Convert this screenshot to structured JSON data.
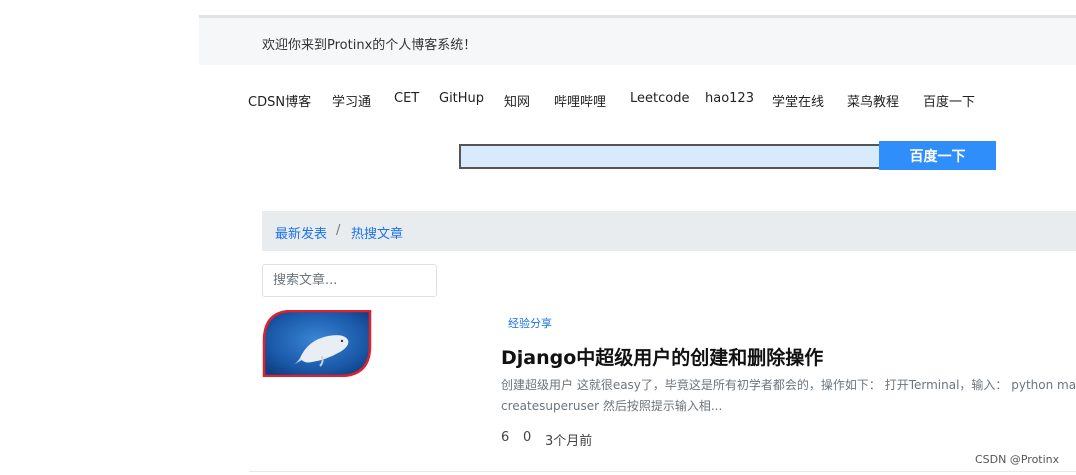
{
  "welcome": {
    "text": "欢迎你来到Protinx的个人博客系统！"
  },
  "nav": {
    "links": [
      "CDSN博客",
      "学习通",
      "CET",
      "GitHup",
      "知网",
      "哔哩哔哩",
      "Leetcode",
      "hao123",
      "学堂在线",
      "菜鸟教程",
      "百度一下"
    ]
  },
  "search": {
    "value": "",
    "button_label": "百度一下"
  },
  "breadcrumb": {
    "items": [
      "最新发表",
      "热搜文章"
    ],
    "separator": "/"
  },
  "article_search": {
    "placeholder": "搜索文章..."
  },
  "article": {
    "thumbnail_icon": "whale-image",
    "category": "经验分享",
    "title": "Django中超级用户的创建和删除操作",
    "summary_line1": "创建超级用户 这就很easy了，毕竟这是所有初学者都会的，操作如下： 打开Terminal，输入： python manage.py",
    "summary_line2": "createsuperuser 然后按照提示输入相...",
    "views": "6",
    "comments": "0",
    "time": "3个月前"
  },
  "watermark": "CSDN @Protinx",
  "colors": {
    "accent": "#2f8ef9",
    "link": "#1a73e8",
    "thumb_border": "#e0202a",
    "thumb_bg": "#1e63b6"
  }
}
